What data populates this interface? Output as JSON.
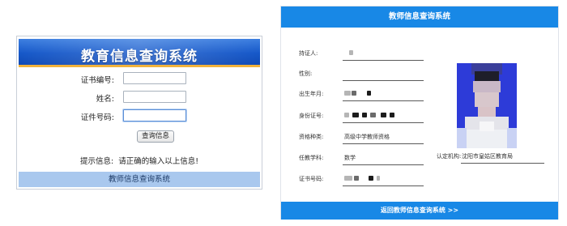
{
  "left": {
    "title": "教育信息查询系统",
    "fields": [
      {
        "label": "证书编号:",
        "value": "",
        "focused": false
      },
      {
        "label": "姓名:",
        "value": "",
        "focused": false
      },
      {
        "label": "证件号码:",
        "value": "",
        "focused": true
      }
    ],
    "query_button": "查询信息",
    "hint_label": "提示信息:",
    "hint_text": "请正确的输入以上信息!",
    "footer": "教师信息查询系统"
  },
  "right": {
    "title": "教师信息查询系统",
    "rows": [
      {
        "label": "持证人:",
        "value": ""
      },
      {
        "label": "性别:",
        "value": ""
      },
      {
        "label": "出生年月:",
        "value": ""
      },
      {
        "label": "身份证号:",
        "value": ""
      },
      {
        "label": "资格种类:",
        "value": "高级中学教师资格"
      },
      {
        "label": "任教学科:",
        "value": "数学"
      },
      {
        "label": "证书号码:",
        "value": ""
      }
    ],
    "issuer_label": "认定机构:",
    "issuer_value": "沈阳市皇姑区教育局",
    "back_link": "返回教师信息查询系统 >>"
  },
  "colors": {
    "header_blue": "#1658c9",
    "header_underline": "#f2b23b",
    "left_footer": "#a9c8ee",
    "right_bar": "#1888e6",
    "photo_bg": "#2d3bd8"
  }
}
